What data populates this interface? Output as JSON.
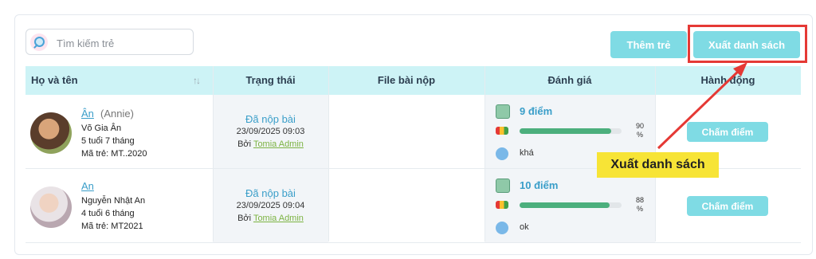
{
  "search": {
    "placeholder": "Tìm kiếm trẻ"
  },
  "toolbar": {
    "add_label": "Thêm trẻ",
    "export_label": "Xuất danh sách"
  },
  "table": {
    "columns": [
      "Họ và tên",
      "Trạng thái",
      "File bài nộp",
      "Đánh giá",
      "Hành động"
    ],
    "rows": [
      {
        "nickname": "Ân",
        "alias": "(Annie)",
        "full_name": "Võ Gia Ân",
        "age": "5 tuổi 7 tháng",
        "code": "Mã trẻ: MT..2020",
        "status": "Đã nộp bài",
        "submitted_at": "23/09/2025 09:03",
        "by_prefix": "Bởi",
        "by_name": "Tomia Admin",
        "score": "9 điểm",
        "progress": 90,
        "progress_value": "90",
        "progress_unit": "%",
        "comment": "khá",
        "action": "Chấm điểm"
      },
      {
        "nickname": "An",
        "alias": "",
        "full_name": "Nguyễn Nhật An",
        "age": "4 tuổi 6 tháng",
        "code": "Mã trẻ: MT2021",
        "status": "Đã nộp bài",
        "submitted_at": "23/09/2025 09:04",
        "by_prefix": "Bởi",
        "by_name": "Tomia Admin",
        "score": "10 điểm",
        "progress": 88,
        "progress_value": "88",
        "progress_unit": "%",
        "comment": "ok",
        "action": "Chấm điểm"
      }
    ]
  },
  "annotation": {
    "callout": "Xuất danh sách",
    "highlight_color": "#e53935",
    "callout_color": "#f7e436"
  },
  "colors": {
    "accent": "#7fdbe4",
    "header_bg": "#cdf3f6",
    "link": "#3a9ec9",
    "progress": "#4caf7d"
  },
  "icons": [
    "search-icon",
    "sort-icon",
    "score-icon",
    "progress-icon",
    "comment-icon"
  ]
}
